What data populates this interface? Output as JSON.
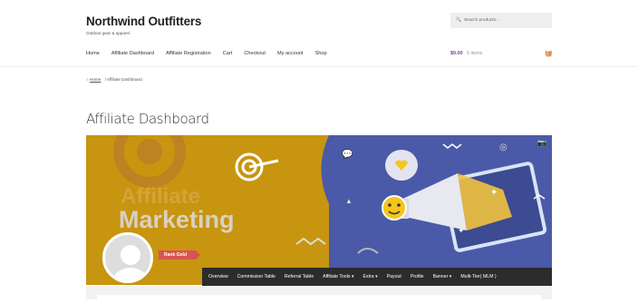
{
  "site": {
    "title": "Northwind Outfitters",
    "tagline": "Outdoor gear & apparel"
  },
  "search": {
    "placeholder": "Search products…",
    "icon": "search-icon"
  },
  "nav": [
    "Home",
    "Affiliate Dashboard",
    "Affiliate Registration",
    "Cart",
    "Checkout",
    "My account",
    "Shop"
  ],
  "cart": {
    "amount": "$0.00",
    "items": "0 items",
    "icon": "basket-icon"
  },
  "breadcrumb": {
    "home": "Home",
    "separator": "/",
    "current": "Affiliate Dashboard"
  },
  "page_title": "Affiliate Dashboard",
  "banner": {
    "line1": "Affiliate",
    "line2": "Marketing",
    "camera_icon": "camera-icon"
  },
  "profile": {
    "rank": "Rank Gold"
  },
  "tabs": [
    "Overview",
    "Commission Table",
    "Referral Table",
    "Affiliate Tools ▾",
    "Extra ▾",
    "Payout",
    "Profile",
    "Banner ▾",
    "Multi-Tier( MLM )"
  ]
}
